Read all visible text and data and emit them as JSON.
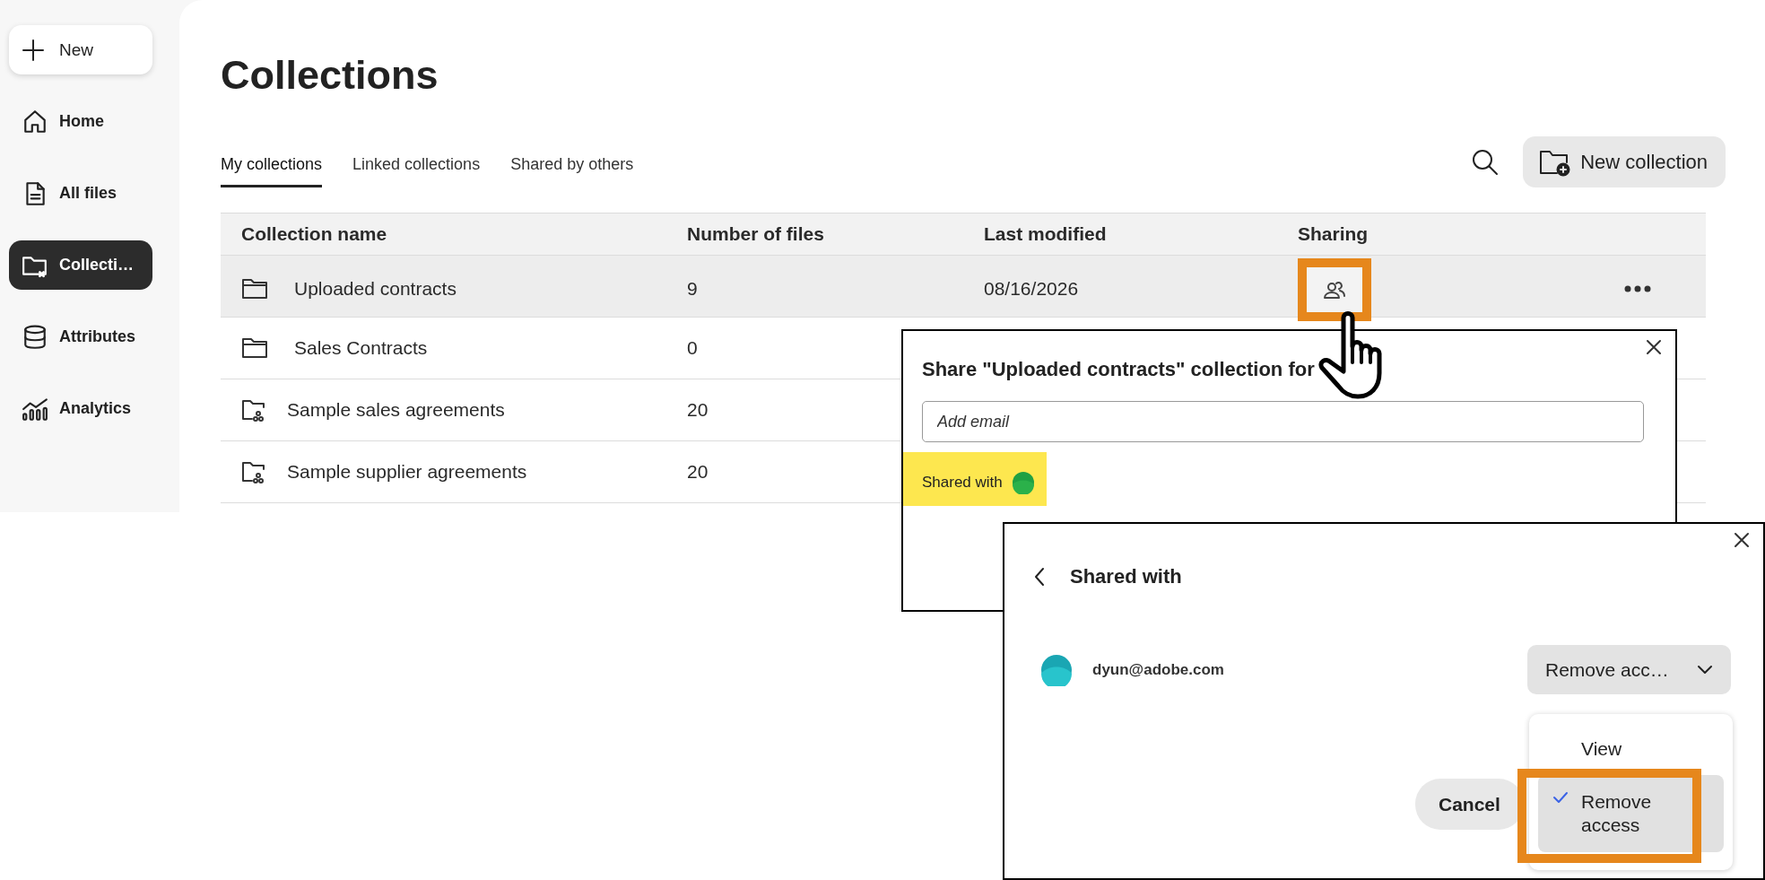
{
  "sidebar": {
    "new_button": "New",
    "items": [
      {
        "label": "Home",
        "selected": false
      },
      {
        "label": "All files",
        "selected": false
      },
      {
        "label": "Collecti…",
        "selected": true
      },
      {
        "label": "Attributes",
        "selected": false
      },
      {
        "label": "Analytics",
        "selected": false
      }
    ]
  },
  "page_title": "Collections",
  "tabs": [
    {
      "label": "My collections",
      "selected": true
    },
    {
      "label": "Linked collections",
      "selected": false
    },
    {
      "label": "Shared by others",
      "selected": false
    }
  ],
  "new_collection_button": "New collection",
  "table": {
    "columns": [
      "Collection name",
      "Number of files",
      "Last modified",
      "Sharing"
    ],
    "rows": [
      {
        "kind": "folder",
        "name": "Uploaded contracts",
        "files": "9",
        "modified": "08/16/2026",
        "hovered": true
      },
      {
        "kind": "folder",
        "name": "Sales Contracts",
        "files": "0",
        "hovered": false
      },
      {
        "kind": "shared",
        "name": "Sample sales agreements",
        "files": "20",
        "hovered": false
      },
      {
        "kind": "shared",
        "name": "Sample supplier agreements",
        "files": "20",
        "hovered": false
      }
    ]
  },
  "share_dialog": {
    "title": "Share \"Uploaded contracts\" collection for",
    "email_placeholder": "Add email",
    "shared_with_label": "Shared with"
  },
  "shared_with_dialog": {
    "title": "Shared with",
    "people": [
      {
        "email": "dyun@adobe.com",
        "access": "Remove acc…"
      }
    ],
    "menu": [
      {
        "label": "View",
        "selected": false
      },
      {
        "label": "Remove access",
        "selected": true
      }
    ],
    "buttons": [
      "Cancel"
    ]
  }
}
